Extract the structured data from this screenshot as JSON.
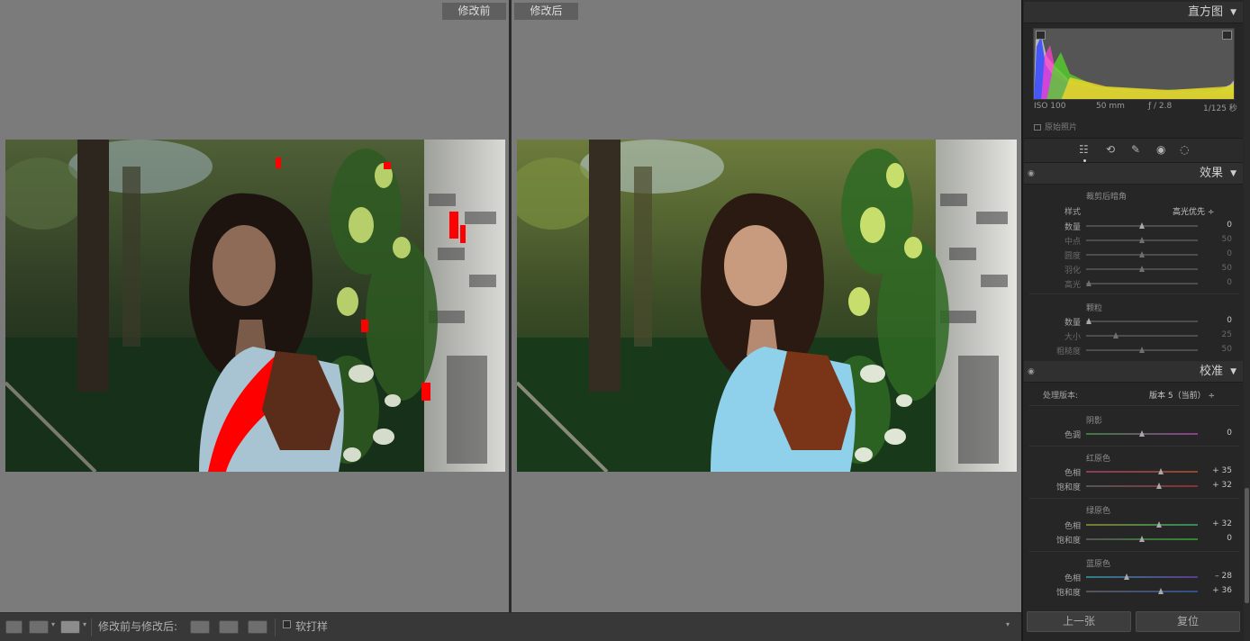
{
  "compare": {
    "before_label": "修改前",
    "after_label": "修改后"
  },
  "toolbar": {
    "view_label": "修改前与修改后:",
    "softproof_label": "软打样"
  },
  "panel": {
    "histogram": {
      "title": "直方图",
      "iso": "ISO 100",
      "focal": "50 mm",
      "aperture": "ƒ / 2.8",
      "shutter": "1/125 秒",
      "original_photo": "原始照片"
    },
    "effects": {
      "title": "效果",
      "vignette_title": "裁剪后暗角",
      "style_label": "样式",
      "style_value": "高光优先 ÷",
      "vignette_rows": [
        {
          "label": "数量",
          "value": "0",
          "knob": 0.5,
          "dim": false
        },
        {
          "label": "中点",
          "value": "50",
          "knob": 0.5,
          "dim": true
        },
        {
          "label": "圆度",
          "value": "0",
          "knob": 0.5,
          "dim": true
        },
        {
          "label": "羽化",
          "value": "50",
          "knob": 0.5,
          "dim": true
        },
        {
          "label": "高光",
          "value": "0",
          "knob": 0.0,
          "dim": true
        }
      ],
      "grain_title": "颗粒",
      "grain_rows": [
        {
          "label": "数量",
          "value": "0",
          "knob": 0.0,
          "dim": false
        },
        {
          "label": "大小",
          "value": "25",
          "knob": 0.25,
          "dim": true
        },
        {
          "label": "粗糙度",
          "value": "50",
          "knob": 0.5,
          "dim": true
        }
      ]
    },
    "calibration": {
      "title": "校准",
      "process_label": "处理版本:",
      "process_value": "版本 5（当前） ÷",
      "shadows_title": "阴影",
      "shadows_tint_label": "色调",
      "shadows_tint_value": "0",
      "red_title": "红原色",
      "red_hue_label": "色相",
      "red_hue_value": "+ 35",
      "red_sat_label": "饱和度",
      "red_sat_value": "+ 32",
      "green_title": "绿原色",
      "green_hue_label": "色相",
      "green_hue_value": "+ 32",
      "green_sat_label": "饱和度",
      "green_sat_value": "0",
      "blue_title": "蓝原色",
      "blue_hue_label": "色相",
      "blue_hue_value": "– 28",
      "blue_sat_label": "饱和度",
      "blue_sat_value": "+ 36"
    },
    "buttons": {
      "previous": "上一张",
      "reset": "复位"
    }
  }
}
